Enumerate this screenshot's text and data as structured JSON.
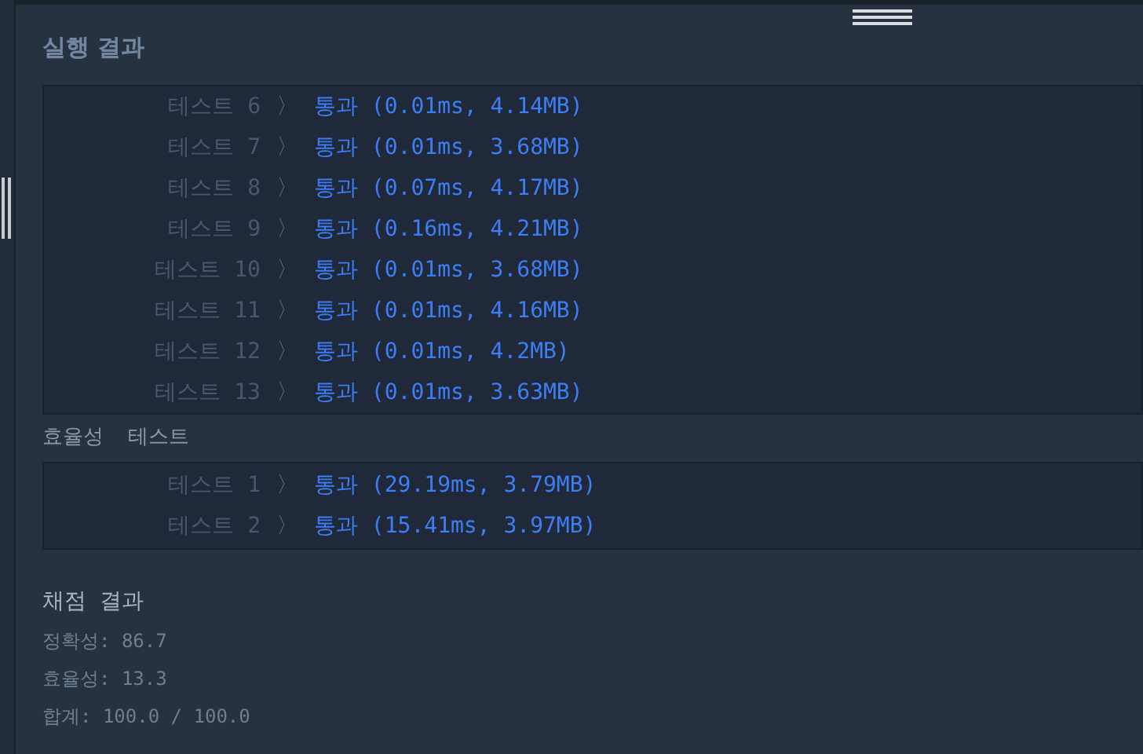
{
  "panel": {
    "title": "실행 결과"
  },
  "accuracy_tests": [
    {
      "label": "테스트 6",
      "chevron": "〉",
      "result": "통과 (0.01ms, 4.14MB)",
      "passed": true
    },
    {
      "label": "테스트 7",
      "chevron": "〉",
      "result": "통과 (0.01ms, 3.68MB)",
      "passed": true
    },
    {
      "label": "테스트 8",
      "chevron": "〉",
      "result": "통과 (0.07ms, 4.17MB)",
      "passed": true
    },
    {
      "label": "테스트 9",
      "chevron": "〉",
      "result": "통과 (0.16ms, 4.21MB)",
      "passed": true
    },
    {
      "label": "테스트 10",
      "chevron": "〉",
      "result": "통과 (0.01ms, 3.68MB)",
      "passed": true
    },
    {
      "label": "테스트 11",
      "chevron": "〉",
      "result": "통과 (0.01ms, 4.16MB)",
      "passed": true
    },
    {
      "label": "테스트 12",
      "chevron": "〉",
      "result": "통과 (0.01ms, 4.2MB)",
      "passed": true
    },
    {
      "label": "테스트 13",
      "chevron": "〉",
      "result": "통과 (0.01ms, 3.63MB)",
      "passed": true
    }
  ],
  "efficiency": {
    "heading": "효율성  테스트",
    "tests": [
      {
        "label": "테스트 1",
        "chevron": "〉",
        "result": "통과 (29.19ms, 3.79MB)",
        "passed": true
      },
      {
        "label": "테스트 2",
        "chevron": "〉",
        "result": "통과 (15.41ms, 3.97MB)",
        "passed": true
      }
    ]
  },
  "grading": {
    "heading": "채점 결과",
    "lines": [
      "정확성: 86.7",
      "효율성: 13.3",
      "합계: 100.0 / 100.0"
    ]
  }
}
